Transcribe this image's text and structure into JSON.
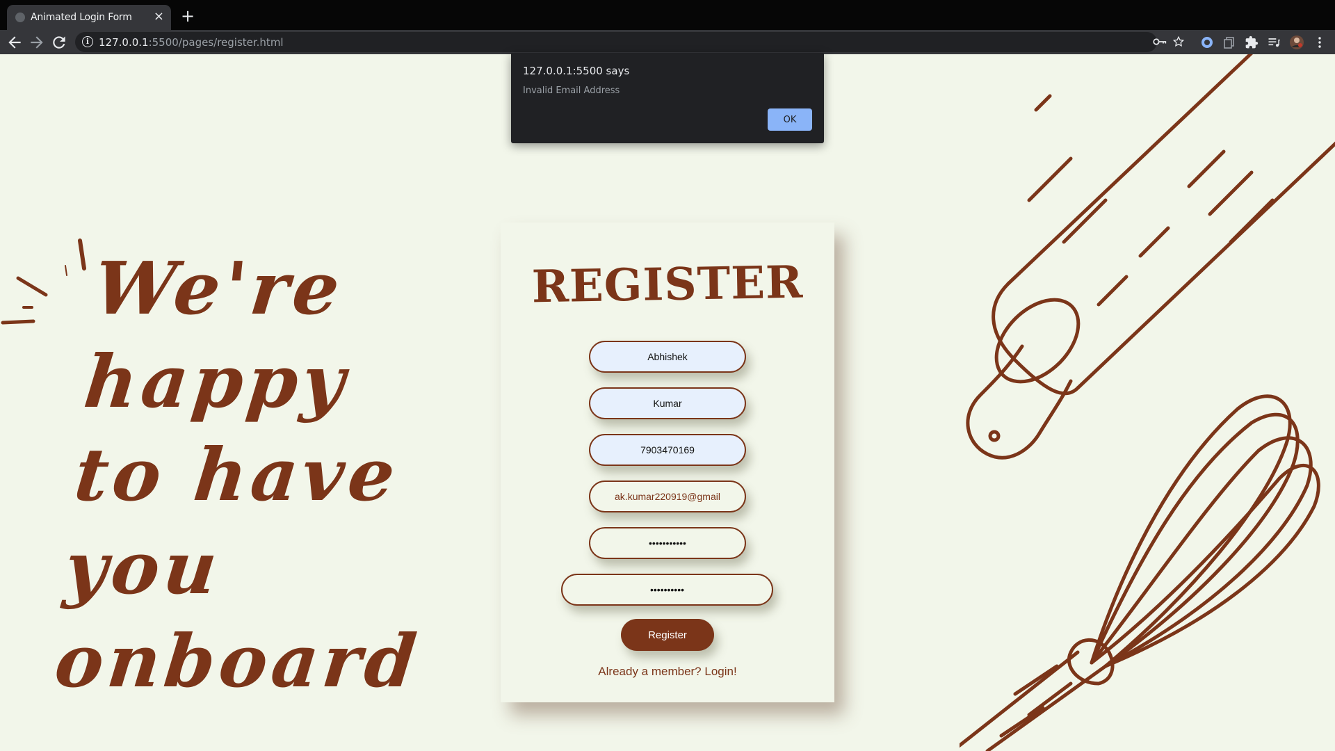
{
  "browser": {
    "tab_title": "Animated Login Form",
    "tab_close": "×",
    "new_tab": "+",
    "url_host": "127.0.0.1",
    "url_rest": ":5500/pages/register.html"
  },
  "dialog": {
    "title": "127.0.0.1:5500 says",
    "message": "Invalid Email Address",
    "ok_label": "OK"
  },
  "hero": {
    "lines": [
      "We're",
      "happy",
      "to have",
      "you",
      "onboard"
    ]
  },
  "form": {
    "title": "REGISTER",
    "first_name": "Abhishek",
    "last_name": "Kumar",
    "phone": "7903470169",
    "email": "ak.kumar220919@gmail",
    "password": "•••••••••••",
    "confirm_password": "••••••••••",
    "submit_label": "Register",
    "login_link": "Already a member? Login!"
  },
  "colors": {
    "brand_brown": "#7b3519",
    "page_bg": "#f2f6ea",
    "autofill_bg": "#e7f0fd",
    "dialog_bg": "#202124",
    "dialog_button": "#8ab4f8"
  }
}
